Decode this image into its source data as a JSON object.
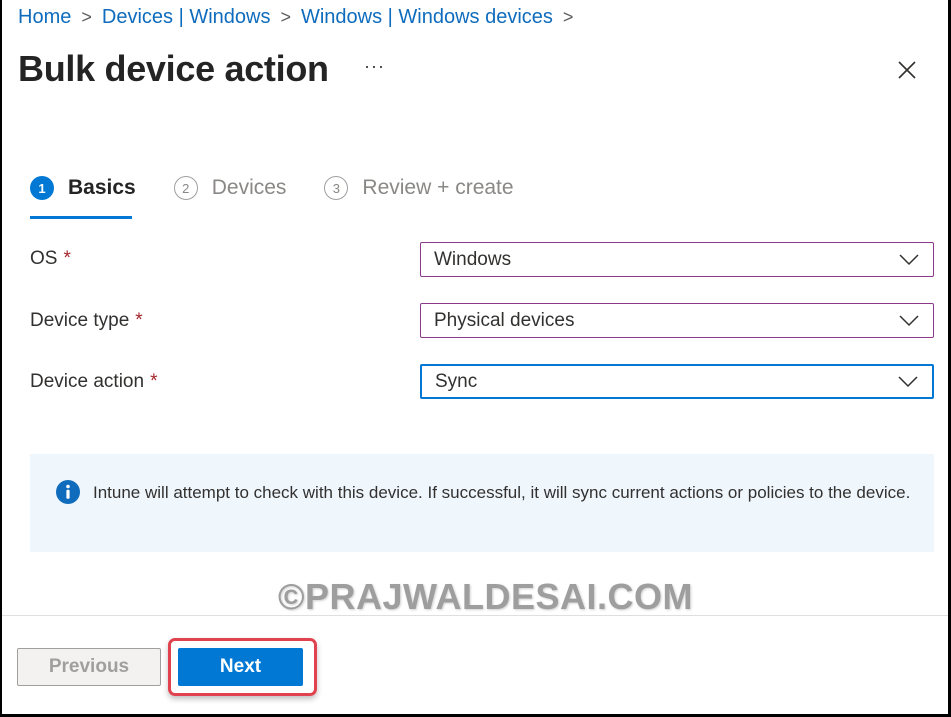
{
  "breadcrumb": [
    "Home",
    "Devices | Windows",
    "Windows | Windows devices"
  ],
  "header": {
    "title": "Bulk device action",
    "more_label": "···"
  },
  "steps": [
    {
      "number": "1",
      "label": "Basics",
      "state": "active"
    },
    {
      "number": "2",
      "label": "Devices",
      "state": "inactive"
    },
    {
      "number": "3",
      "label": "Review + create",
      "state": "inactive"
    }
  ],
  "form": {
    "os": {
      "label": "OS",
      "required": "*",
      "value": "Windows"
    },
    "device_type": {
      "label": "Device type",
      "required": "*",
      "value": "Physical devices"
    },
    "device_action": {
      "label": "Device action",
      "required": "*",
      "value": "Sync"
    }
  },
  "info": {
    "text": "Intune will attempt to check with this device. If successful, it will sync current actions or policies to the device."
  },
  "watermark": "©PRAJWALDESAI.COM",
  "footer": {
    "previous_label": "Previous",
    "next_label": "Next"
  },
  "colors": {
    "accent": "#0078d4",
    "required": "#a4262c",
    "highlight": "#e0434f"
  }
}
